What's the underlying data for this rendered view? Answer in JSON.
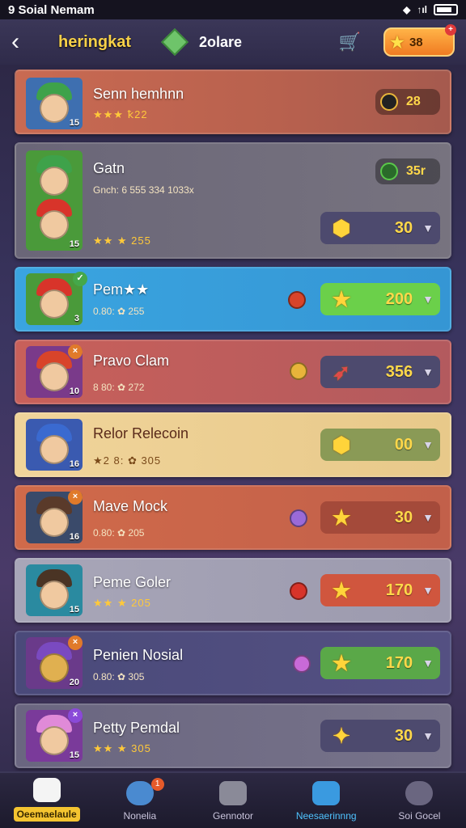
{
  "status": {
    "carrier": "9 Soial Nemam",
    "signal": "↑ıl"
  },
  "header": {
    "back": "‹",
    "title": "heringkat",
    "gem_count": "2olare",
    "coins": "38",
    "coin_plus": "+"
  },
  "rows": [
    {
      "name": "Senn hemhnn",
      "sub": "★★★ ꝁ22",
      "level": "15",
      "price": "28",
      "price_icon": "●"
    },
    {
      "name": "Gatn",
      "sub": "Gnch: 6 555 334 1033x",
      "sub2": "★★ ★ 255",
      "level": "15",
      "top_price": "35r",
      "price": "30",
      "price_icon": "⬢"
    },
    {
      "name": "Pem★★",
      "sub": "0.80: ✿ 255",
      "level": "3",
      "price": "200",
      "price_icon": "★"
    },
    {
      "name": "Pravo Clam",
      "sub": "8 80: ✿ 272",
      "level": "10",
      "price": "356",
      "price_icon": "➶"
    },
    {
      "name": "Relor Relecoin",
      "sub": "★2 8: ✿ 305",
      "level": "16",
      "price": "00",
      "price_icon": "⬢"
    },
    {
      "name": "Mave Mock",
      "sub": "0.80: ✿ 205",
      "level": "16",
      "price": "30",
      "price_icon": "★"
    },
    {
      "name": "Peme Goler",
      "sub": "★★ ★ 205",
      "level": "15",
      "price": "170",
      "price_icon": "★"
    },
    {
      "name": "Penien Nosial",
      "sub": "0.80: ✿ 305",
      "level": "20",
      "price": "170",
      "price_icon": "★"
    },
    {
      "name": "Petty Pemdal",
      "sub": "★★ ★ 305",
      "level": "15",
      "price": "30",
      "price_icon": "✦"
    }
  ],
  "tabs": [
    {
      "label": "Oeemaelaule"
    },
    {
      "label": "Nonelia",
      "notif": "1"
    },
    {
      "label": "Gennotor"
    },
    {
      "label": "Neesaerinnng"
    },
    {
      "label": "Soi Gocel"
    }
  ]
}
